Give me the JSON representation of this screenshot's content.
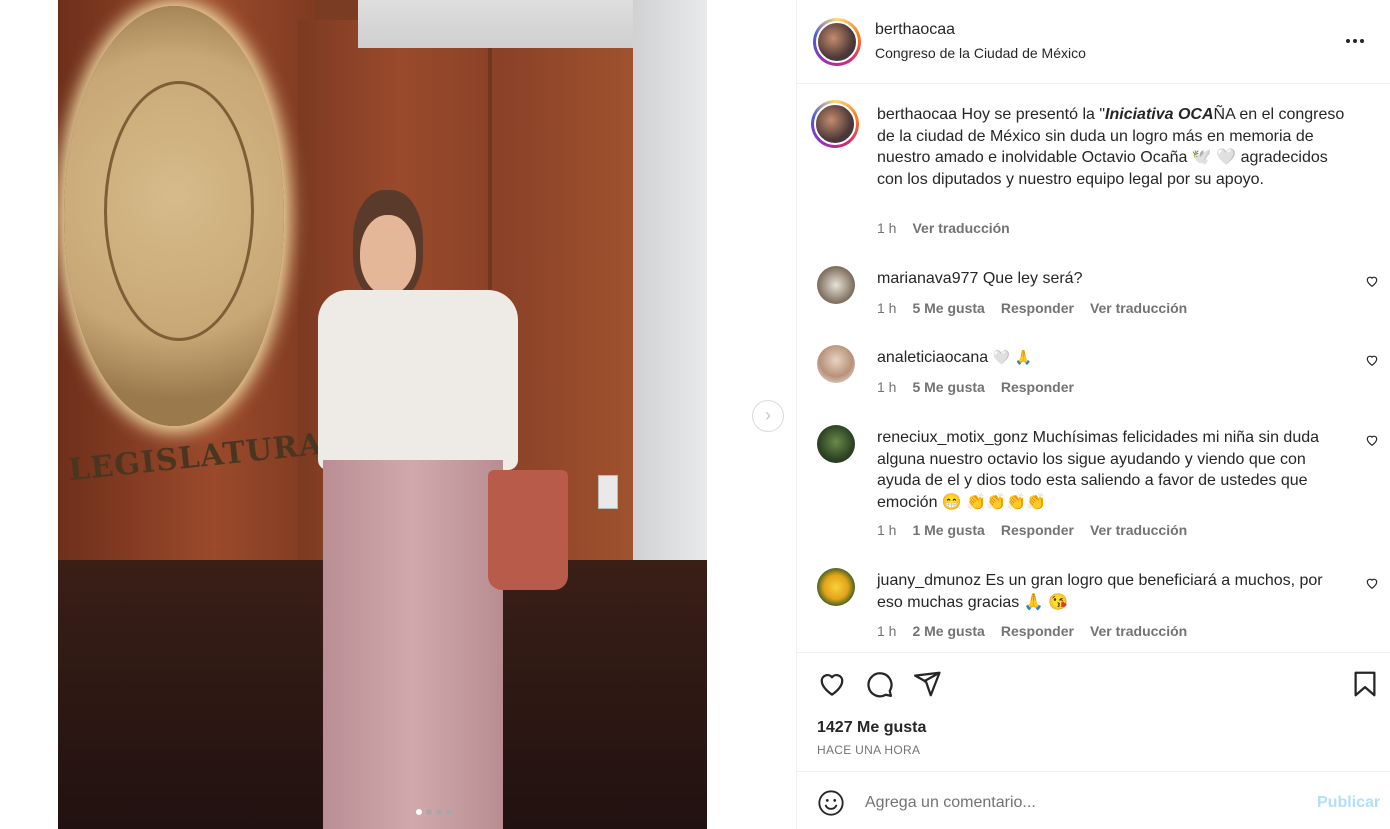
{
  "post": {
    "author": "berthaocaa",
    "location": "Congreso de la Ciudad de México",
    "more_label": "•••"
  },
  "media": {
    "plaque_text": "LEGISLATURA",
    "carousel_count": 4,
    "carousel_active": 1,
    "next_label": "›"
  },
  "caption": {
    "username": "berthaocaa",
    "text_before": "Hoy se presentó la \"",
    "bold_italic": "Iniciativa OCA",
    "text_after": "ÑA en el congreso de la ciudad de México sin duda un logro más en memoria de nuestro amado e inolvidable Octavio Ocaña 🕊️ 🤍 agradecidos con los diputados y nuestro equipo legal por su apoyo.",
    "time": "1 h",
    "translate": "Ver traducción"
  },
  "comments": [
    {
      "username": "marianava977",
      "text": "Que ley será?",
      "time": "1 h",
      "likes": "5 Me gusta",
      "reply": "Responder",
      "translate": "Ver traducción"
    },
    {
      "username": "analeticiaocana",
      "text": "🤍 🙏",
      "time": "1 h",
      "likes": "5 Me gusta",
      "reply": "Responder",
      "translate": ""
    },
    {
      "username": "reneciux_motix_gonz",
      "text": "Muchísimas felicidades mi niña sin duda alguna nuestro octavio los sigue ayudando y viendo que con ayuda de el y dios todo esta saliendo a favor de ustedes que emoción 😁 👏👏👏👏",
      "time": "1 h",
      "likes": "1 Me gusta",
      "reply": "Responder",
      "translate": "Ver traducción"
    },
    {
      "username": "juany_dmunoz",
      "text": "Es un gran logro que beneficiará a muchos, por eso muchas gracias 🙏 😘",
      "time": "1 h",
      "likes": "2 Me gusta",
      "reply": "Responder",
      "translate": "Ver traducción"
    }
  ],
  "stats": {
    "likes": "1427 Me gusta",
    "time_ago": "HACE UNA HORA"
  },
  "composer": {
    "placeholder": "Agrega un comentario...",
    "post_label": "Publicar"
  },
  "colors": {
    "text": "#262626",
    "muted": "#737373",
    "link_disabled": "#b2dffc",
    "border": "#efefef"
  }
}
